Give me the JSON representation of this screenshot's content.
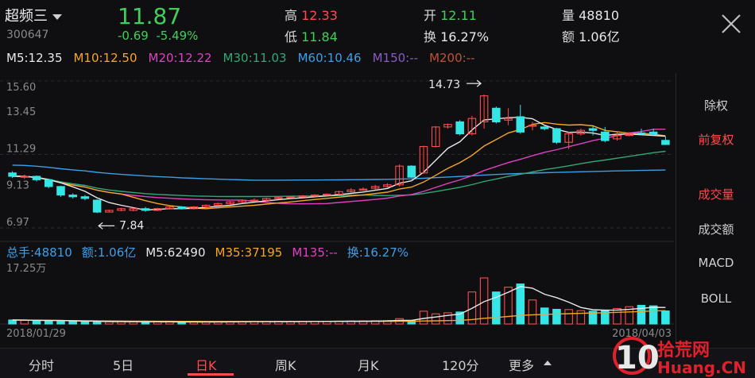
{
  "header": {
    "stock_name": "超频三",
    "stock_code": "300647",
    "price": "11.87",
    "change": "-0.69",
    "change_pct": "-5.49%",
    "high_label": "高",
    "high_value": "12.33",
    "low_label": "低",
    "low_value": "11.84",
    "open_label": "开",
    "open_value": "12.11",
    "turnover_label": "换",
    "turnover_value": "16.27%",
    "volume_label": "量",
    "volume_value": "48810",
    "amount_label": "额",
    "amount_value": "1.06亿"
  },
  "ma": [
    {
      "text": "M5:12.35",
      "color": "#e8e8e8"
    },
    {
      "text": "M10:12.50",
      "color": "#f5a623"
    },
    {
      "text": "M20:12.22",
      "color": "#e040c0"
    },
    {
      "text": "M30:11.03",
      "color": "#2ea876"
    },
    {
      "text": "M60:10.46",
      "color": "#3aa0e8"
    },
    {
      "text": "M150:--",
      "color": "#8a5ac8"
    },
    {
      "text": "M200:--",
      "color": "#c0532e"
    }
  ],
  "volume_stats": [
    {
      "text": "总手:48810",
      "color": "#3aa0e8"
    },
    {
      "text": "额:1.06亿",
      "color": "#3aa0e8"
    },
    {
      "text": "M5:62490",
      "color": "#e8e8e8"
    },
    {
      "text": "M35:37195",
      "color": "#f5a623"
    },
    {
      "text": "M135:--",
      "color": "#e040c0"
    },
    {
      "text": "换:16.27%",
      "color": "#3aa0e8"
    }
  ],
  "side_menu": [
    {
      "label": "除权",
      "active": false
    },
    {
      "label": "前复权",
      "active": true
    },
    {
      "label": "成交量",
      "active": true
    },
    {
      "label": "成交额",
      "active": false
    },
    {
      "label": "MACD",
      "active": false
    },
    {
      "label": "BOLL",
      "active": false
    }
  ],
  "tabs": [
    {
      "label": "分时",
      "active": false
    },
    {
      "label": "5日",
      "active": false
    },
    {
      "label": "日K",
      "active": true
    },
    {
      "label": "周K",
      "active": false
    },
    {
      "label": "月K",
      "active": false
    },
    {
      "label": "120分",
      "active": false
    },
    {
      "label": "更多",
      "active": false
    }
  ],
  "watermark": "10拾荒网 Huang.CN",
  "colors": {
    "up": "#ff4b4b",
    "down": "#35e6e6",
    "ma5": "#e8e8e8",
    "ma10": "#f5a623",
    "ma20": "#e040c0",
    "ma30": "#2ea876",
    "ma60": "#3aa0e8"
  },
  "chart_data": {
    "type": "candlestick",
    "ylim": [
      6.97,
      15.6
    ],
    "yticks": [
      "15.60",
      "13.45",
      "11.29",
      "9.13",
      "6.97"
    ],
    "high_marker": "14.73",
    "low_marker": "7.84",
    "volume_max_label": "17.25万",
    "volume_max": 172500,
    "x_start_label": "2018/01/29",
    "x_end_label": "2018/04/03",
    "candles": [
      [
        10.2,
        10.0,
        10.3,
        9.9
      ],
      [
        10.0,
        10.0,
        10.1,
        9.85
      ],
      [
        10.0,
        9.8,
        10.05,
        9.7
      ],
      [
        9.8,
        9.4,
        9.85,
        9.3
      ],
      [
        9.4,
        8.9,
        9.45,
        8.8
      ],
      [
        8.9,
        8.8,
        9.0,
        8.7
      ],
      [
        8.8,
        8.7,
        8.9,
        8.6
      ],
      [
        8.6,
        7.9,
        8.65,
        7.84
      ],
      [
        7.9,
        8.0,
        8.05,
        7.88
      ],
      [
        8.0,
        8.1,
        8.15,
        7.95
      ],
      [
        8.0,
        8.1,
        8.15,
        7.95
      ],
      [
        8.1,
        8.0,
        8.2,
        7.92
      ],
      [
        8.0,
        8.1,
        8.15,
        7.95
      ],
      [
        8.1,
        8.2,
        8.25,
        8.05
      ],
      [
        8.2,
        8.1,
        8.25,
        8.05
      ],
      [
        8.1,
        8.2,
        8.25,
        8.05
      ],
      [
        8.2,
        8.3,
        8.35,
        8.15
      ],
      [
        8.3,
        8.4,
        8.45,
        8.25
      ],
      [
        8.4,
        8.5,
        8.55,
        8.35
      ],
      [
        8.5,
        8.6,
        8.65,
        8.45
      ],
      [
        8.6,
        8.6,
        8.7,
        8.55
      ],
      [
        8.6,
        8.7,
        8.75,
        8.55
      ],
      [
        8.7,
        8.75,
        8.8,
        8.65
      ],
      [
        8.75,
        8.8,
        8.85,
        8.7
      ],
      [
        8.8,
        8.85,
        8.9,
        8.75
      ],
      [
        8.85,
        8.9,
        8.95,
        8.8
      ],
      [
        8.9,
        8.95,
        9.0,
        8.85
      ],
      [
        8.95,
        9.1,
        9.15,
        8.9
      ],
      [
        9.1,
        9.2,
        9.3,
        9.05
      ],
      [
        9.2,
        9.25,
        9.35,
        9.15
      ],
      [
        9.3,
        9.4,
        9.5,
        9.2
      ],
      [
        9.4,
        9.5,
        9.6,
        9.35
      ],
      [
        9.5,
        10.6,
        10.7,
        9.4
      ],
      [
        10.6,
        9.95,
        10.65,
        9.9
      ],
      [
        10.2,
        11.75,
        11.8,
        10.15
      ],
      [
        11.75,
        12.9,
        12.95,
        11.7
      ],
      [
        12.9,
        13.05,
        13.1,
        12.8
      ],
      [
        13.2,
        12.5,
        13.3,
        12.4
      ],
      [
        12.5,
        13.4,
        13.55,
        12.4
      ],
      [
        13.2,
        14.73,
        14.8,
        12.8
      ],
      [
        14.0,
        13.2,
        14.1,
        13.1
      ],
      [
        13.3,
        13.4,
        14.0,
        13.0
      ],
      [
        13.5,
        12.6,
        14.2,
        12.5
      ],
      [
        13.0,
        13.0,
        13.2,
        12.7
      ],
      [
        12.9,
        12.8,
        13.0,
        12.7
      ],
      [
        12.8,
        12.0,
        12.85,
        11.9
      ],
      [
        12.0,
        12.5,
        12.6,
        11.6
      ],
      [
        12.5,
        12.7,
        12.8,
        12.4
      ],
      [
        12.8,
        12.7,
        13.0,
        12.4
      ],
      [
        12.6,
        12.1,
        12.9,
        12.0
      ],
      [
        12.2,
        12.4,
        12.6,
        12.1
      ],
      [
        12.4,
        12.5,
        12.6,
        12.35
      ],
      [
        12.55,
        12.5,
        12.8,
        12.4
      ],
      [
        12.6,
        12.5,
        12.8,
        12.4
      ],
      [
        12.11,
        11.87,
        12.33,
        11.84
      ]
    ],
    "volumes": [
      15000,
      14000,
      13000,
      12000,
      11000,
      10000,
      9000,
      8000,
      8500,
      9000,
      8000,
      7500,
      8000,
      7800,
      7200,
      8200,
      7900,
      8300,
      8600,
      8800,
      9000,
      8800,
      9200,
      9500,
      9700,
      10000,
      10200,
      10500,
      11000,
      11500,
      12000,
      12500,
      20000,
      12000,
      48000,
      38000,
      42000,
      45000,
      120000,
      172500,
      120000,
      138000,
      150000,
      90000,
      60000,
      55000,
      54000,
      50000,
      48000,
      52000,
      58000,
      65000,
      70000,
      68000,
      48810
    ]
  }
}
